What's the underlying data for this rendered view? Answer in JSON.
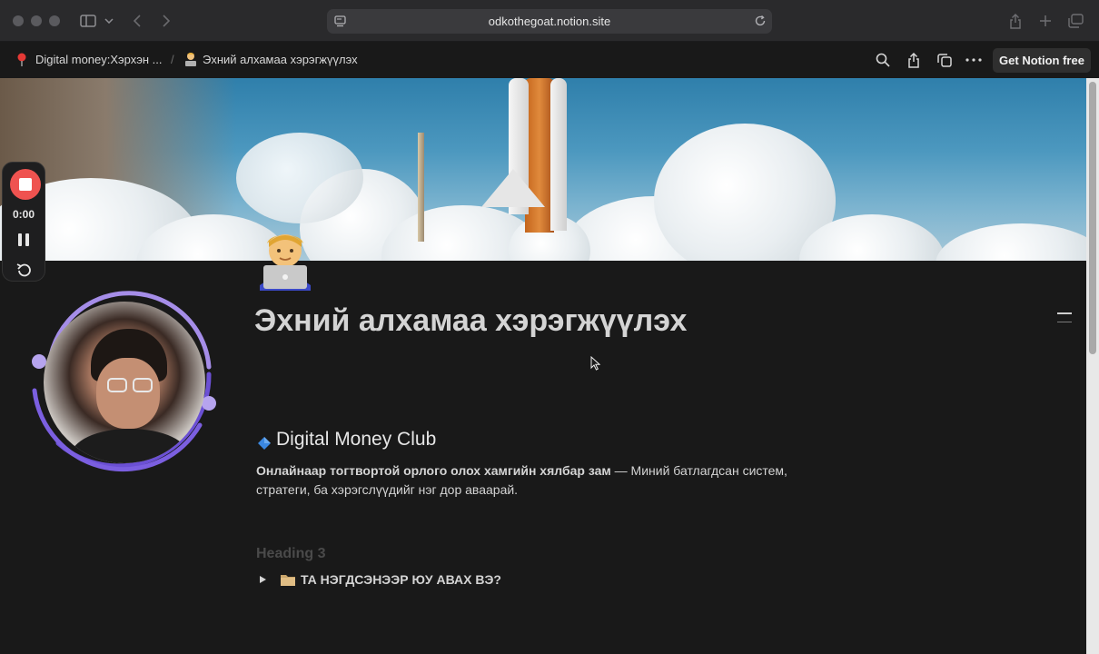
{
  "browser": {
    "url": "odkothegoat.notion.site"
  },
  "notion_bar": {
    "breadcrumbs": [
      {
        "label": "Digital money:Хэрхэн ..."
      },
      {
        "label": "Эхний алхамаа хэрэгжүүлэх"
      }
    ],
    "separator": "/",
    "get_notion_label": "Get Notion free"
  },
  "recorder": {
    "time": "0:00"
  },
  "page": {
    "title": "Эхний алхамаа хэрэгжүүлэх",
    "heading2": "Digital Money Club",
    "paragraph_bold": "Онлайнаар тогтвортой орлого олох хамгийн хялбар зам",
    "paragraph_rest": " — Миний батлагдсан систем, стратеги, ба хэрэгслүүдийг нэг дор аваарай.",
    "heading3_placeholder": "Heading 3",
    "toggle_label": "ТА НЭГДСЭНЭЭР ЮУ АВАХ ВЭ?"
  },
  "colors": {
    "recorder_stop": "#ef5350",
    "webcam_ring": "#8b6fe0"
  }
}
